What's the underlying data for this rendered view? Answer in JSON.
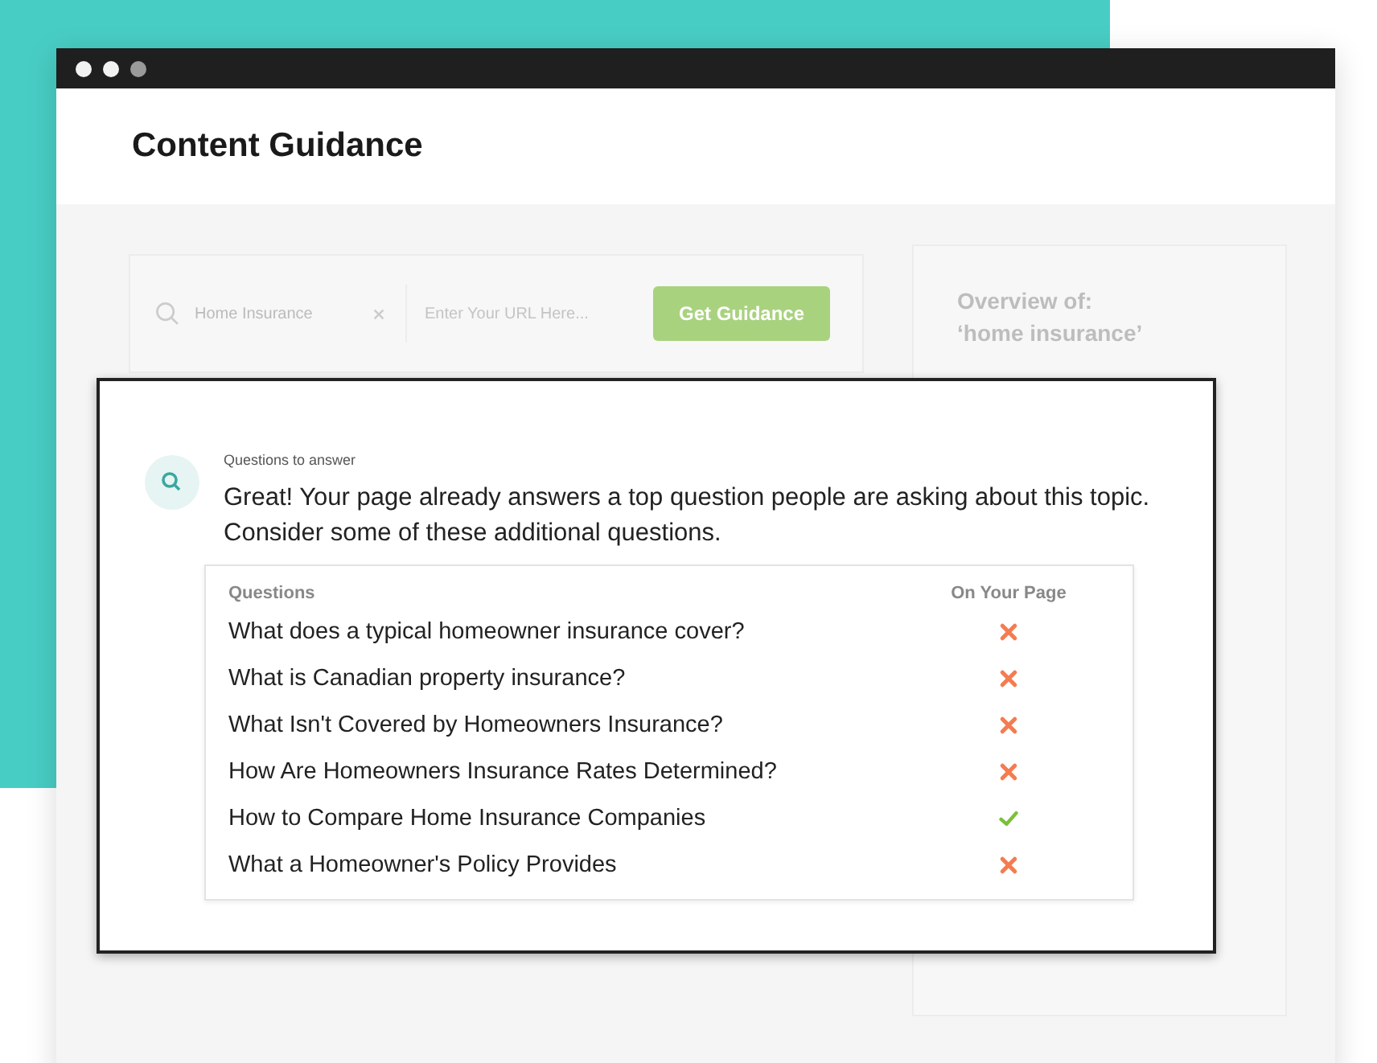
{
  "window": {
    "title": "Content Guidance"
  },
  "search": {
    "value": "Home Insurance",
    "url_placeholder": "Enter Your URL Here...",
    "button": "Get Guidance"
  },
  "overview": {
    "title": "Overview of:",
    "topic": "‘home insurance’"
  },
  "panel": {
    "label": "Questions to answer",
    "message": "Great! Your page already answers a top question people are asking about this topic. Consider some of these additional questions.",
    "columns": [
      "Questions",
      "On Your Page"
    ],
    "rows": [
      {
        "question": "What does a typical homeowner insurance cover?",
        "on_page": false
      },
      {
        "question": "What is Canadian property insurance?",
        "on_page": false
      },
      {
        "question": "What Isn't Covered by Homeowners Insurance?",
        "on_page": false
      },
      {
        "question": "How Are Homeowners Insurance Rates Determined?",
        "on_page": false
      },
      {
        "question": "How to Compare Home Insurance Companies",
        "on_page": true
      },
      {
        "question": "What a Homeowner's Policy Provides",
        "on_page": false
      }
    ]
  }
}
